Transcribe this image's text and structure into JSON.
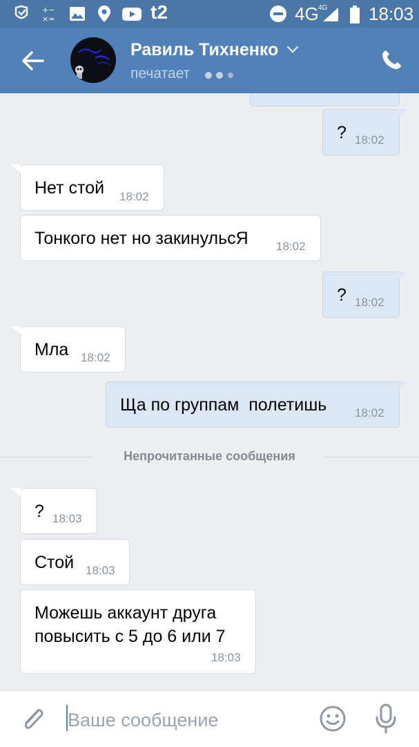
{
  "status_bar": {
    "network": "4G",
    "network_small": "4G",
    "carrier_logo": "t2",
    "time": "18:03",
    "icons": [
      "notification-icon",
      "calculator-icon",
      "gallery-icon",
      "location-icon",
      "youtube-icon",
      "dnd-icon",
      "signal-icon",
      "battery-icon"
    ]
  },
  "header": {
    "contact_name": "Равиль Тихненко",
    "status": "печатает",
    "colors": {
      "bar": "#5181b8",
      "status_bar": "#4a76a8"
    }
  },
  "messages": [
    {
      "dir": "out",
      "text": "?",
      "time": "18:02"
    },
    {
      "dir": "in",
      "text": "Нет стой",
      "time": "18:02"
    },
    {
      "dir": "in",
      "text": "Тонкого нет но закинульсЯ",
      "time": "18:02"
    },
    {
      "dir": "out",
      "text": "?",
      "time": "18:02"
    },
    {
      "dir": "in",
      "text": "Мла",
      "time": "18:02"
    },
    {
      "dir": "out",
      "text": "Ща по группам  полетишь",
      "time": "18:02"
    },
    {
      "dir": "in",
      "text": "?",
      "time": "18:03"
    },
    {
      "dir": "in",
      "text": "Стой",
      "time": "18:03"
    },
    {
      "dir": "in",
      "text": "Можешь аккаунт друга\nповысить с 5 до 6 или 7",
      "time": "18:03"
    }
  ],
  "unread_divider": "Непрочитанные сообщения",
  "input": {
    "placeholder": "Ваше сообщение",
    "value": ""
  },
  "colors": {
    "incoming_bubble": "#ffffff",
    "outgoing_bubble": "#dce7f5",
    "background": "#edeef0"
  }
}
